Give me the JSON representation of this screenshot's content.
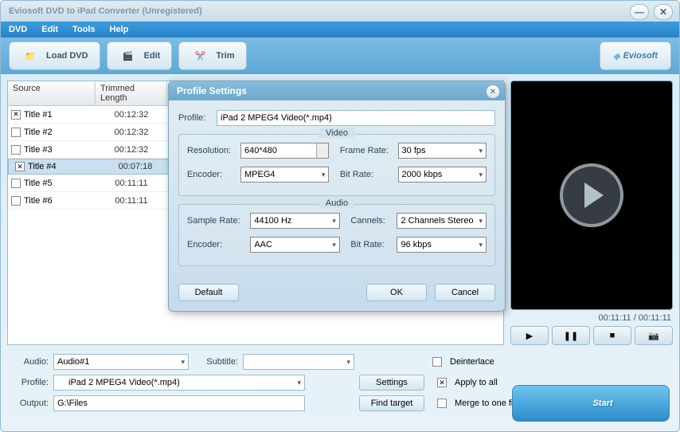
{
  "window": {
    "title": "Eviosoft DVD to iPad Converter (Unregistered)"
  },
  "menu": {
    "dvd": "DVD",
    "edit": "Edit",
    "tools": "Tools",
    "help": "Help"
  },
  "toolbar": {
    "load": "Load DVD",
    "edit": "Edit",
    "trim": "Trim",
    "brand": "Eviosoft"
  },
  "table": {
    "headers": [
      "Source",
      "Trimmed Length"
    ],
    "rows": [
      {
        "checked": true,
        "title": "Title #1",
        "len": "00:12:32",
        "selected": false
      },
      {
        "checked": false,
        "title": "Title #2",
        "len": "00:12:32",
        "selected": false
      },
      {
        "checked": false,
        "title": "Title #3",
        "len": "00:12:32",
        "selected": false
      },
      {
        "checked": true,
        "title": "Title #4",
        "len": "00:07:18",
        "selected": true
      },
      {
        "checked": false,
        "title": "Title #5",
        "len": "00:11:11",
        "selected": false
      },
      {
        "checked": false,
        "title": "Title #6",
        "len": "00:11:11",
        "selected": false
      }
    ]
  },
  "preview": {
    "time": "00:11:11 / 00:11:11"
  },
  "form": {
    "audio_label": "Audio:",
    "audio_value": "Audio#1",
    "subtitle_label": "Subtitle:",
    "subtitle_value": "",
    "profile_label": "Profile:",
    "profile_value": "iPad 2 MPEG4 Video(*.mp4)",
    "output_label": "Output:",
    "output_value": "G:\\Files",
    "settings_btn": "Settings",
    "find_btn": "Find target",
    "deinterlace": "Deinterlace",
    "apply_all": "Apply to all",
    "merge": "Merge to one file",
    "apply_checked": true,
    "deinterlace_checked": false,
    "merge_checked": false,
    "start": "Start"
  },
  "dialog": {
    "title": "Profile Settings",
    "profile_label": "Profile:",
    "profile_value": "iPad 2 MPEG4 Video(*.mp4)",
    "video_legend": "Video",
    "res_label": "Resolution:",
    "res_value": "640*480",
    "fr_label": "Frame Rate:",
    "fr_value": "30 fps",
    "venc_label": "Encoder:",
    "venc_value": "MPEG4",
    "vbr_label": "Bit Rate:",
    "vbr_value": "2000 kbps",
    "audio_legend": "Audio",
    "sr_label": "Sample Rate:",
    "sr_value": "44100 Hz",
    "ch_label": "Cannels:",
    "ch_value": "2 Channels Stereo",
    "aenc_label": "Encoder:",
    "aenc_value": "AAC",
    "abr_label": "Bit Rate:",
    "abr_value": "96 kbps",
    "default_btn": "Default",
    "ok_btn": "OK",
    "cancel_btn": "Cancel"
  }
}
